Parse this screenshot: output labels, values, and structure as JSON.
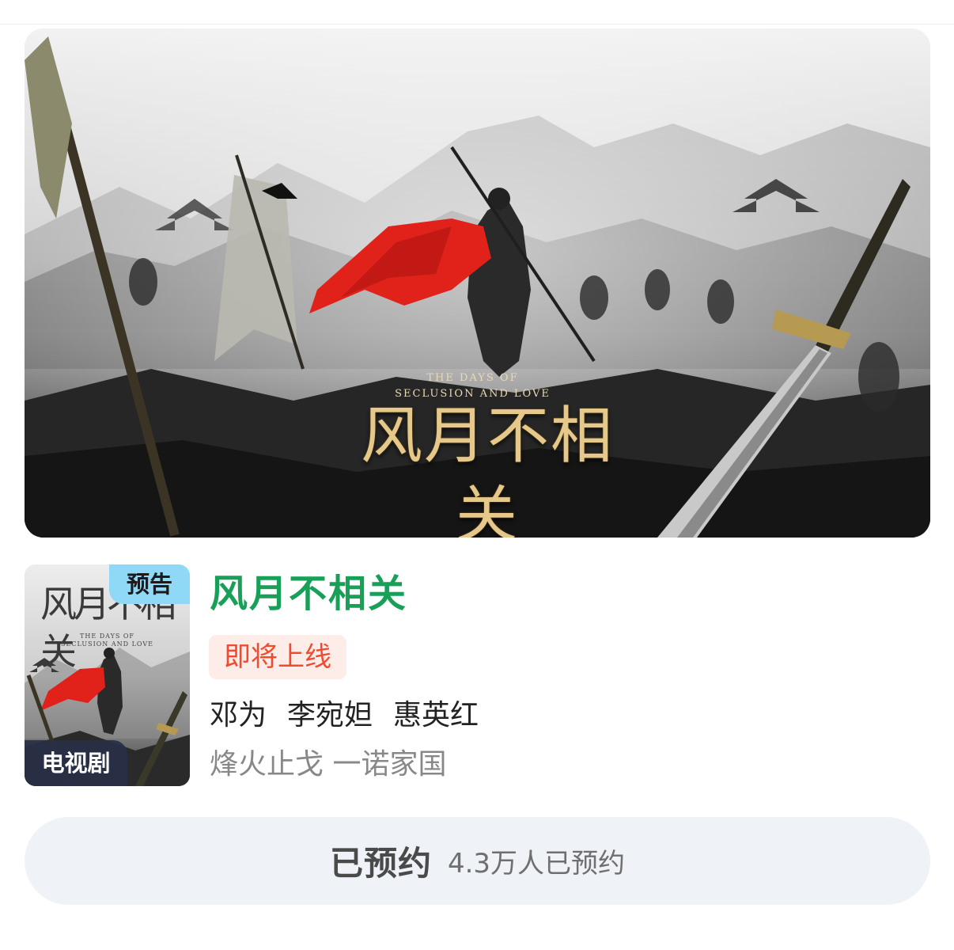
{
  "banner": {
    "subtitle_line1": "THE DAYS OF",
    "subtitle_line2": "SECLUSION AND LOVE",
    "title_art": "风月不相关"
  },
  "poster": {
    "title_art": "风月不相关",
    "subtitle_line1": "THE DAYS OF",
    "subtitle_line2": "SECLUSION AND LOVE",
    "trailer_badge": "预告",
    "type_badge": "电视剧"
  },
  "show": {
    "title": "风月不相关",
    "status": "即将上线",
    "cast": [
      "邓为",
      "李宛妲",
      "惠英红"
    ],
    "tagline": "烽火止戈 一诺家国"
  },
  "reserve": {
    "label": "已预约",
    "count_text": "4.3万人已预约"
  },
  "colors": {
    "title_green": "#18a058",
    "status_red": "#f24a2e",
    "status_bg": "#fdece8",
    "trailer_badge_bg": "#8fd8f6",
    "type_badge_bg": "#283048",
    "button_bg": "#eff2f7"
  }
}
